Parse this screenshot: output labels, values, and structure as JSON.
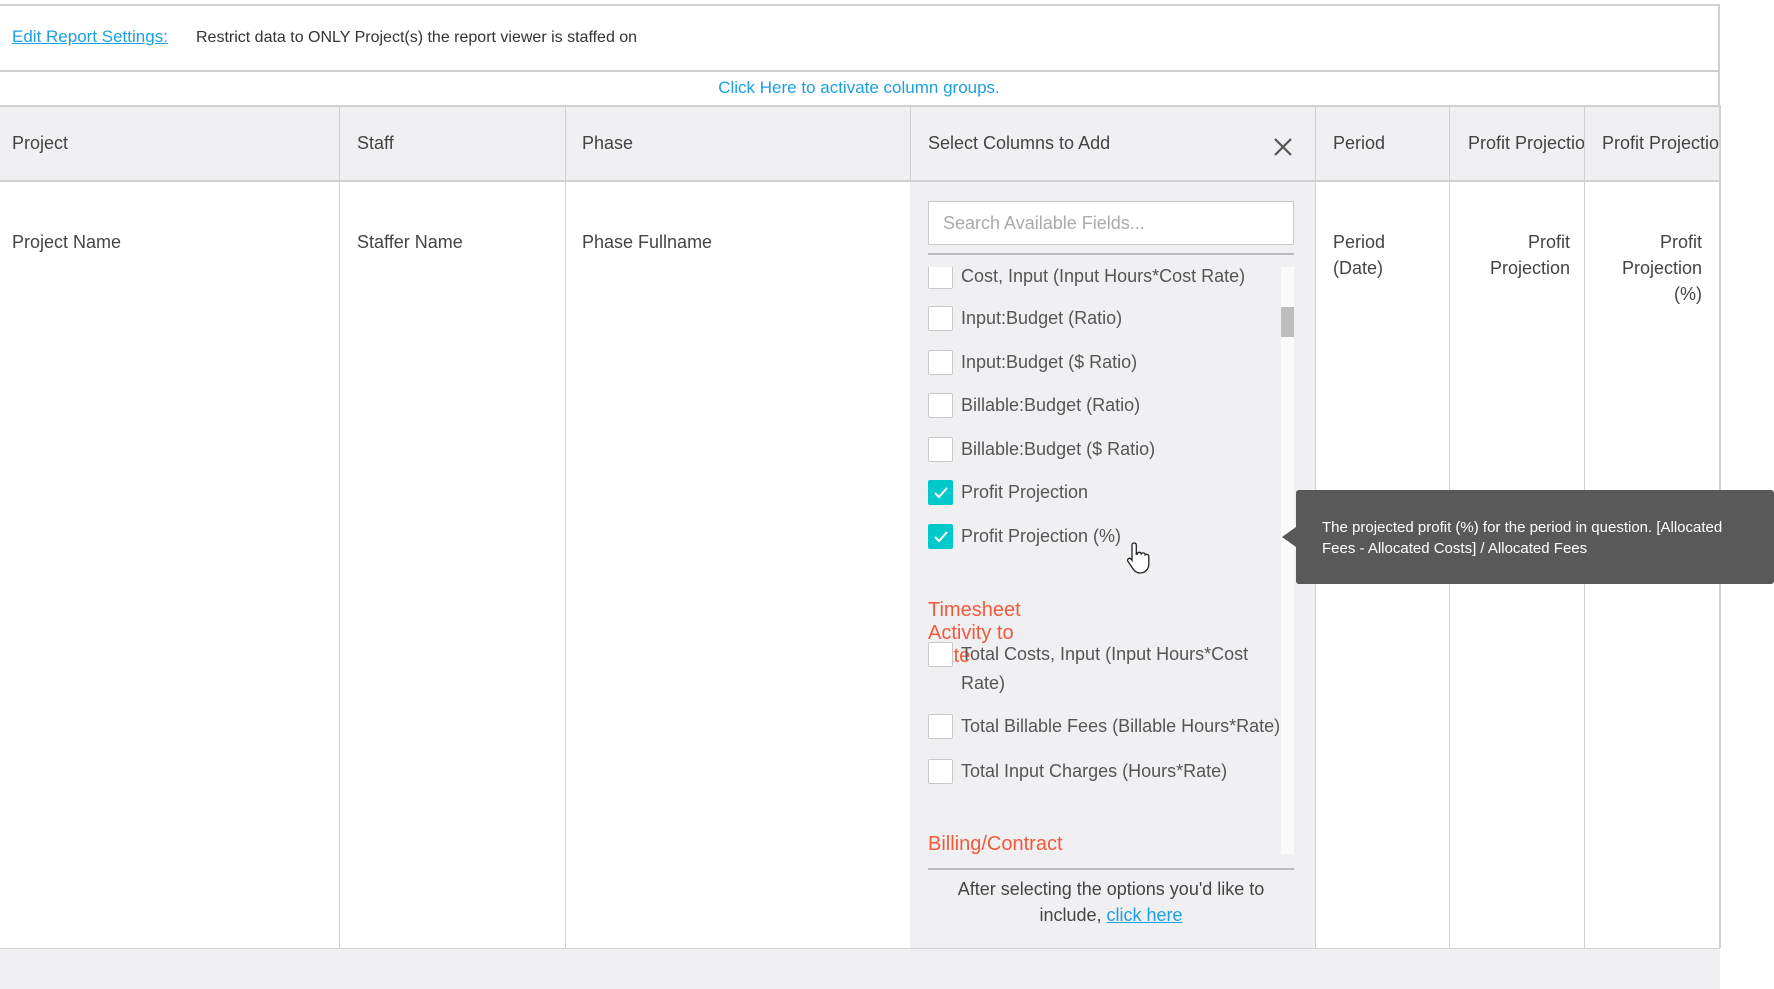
{
  "header": {
    "edit_link": "Edit Report Settings:",
    "restriction_text": "Restrict data to ONLY Project(s) the report viewer is staffed on"
  },
  "column_groups_link": "Click Here to activate column groups.",
  "table": {
    "columns": [
      "Project",
      "Staff",
      "Phase",
      "Select Columns to Add",
      "Period",
      "Profit Projectio",
      "Profit Projectio"
    ],
    "row": [
      "Project Name",
      "Staffer Name",
      "Phase Fullname",
      "Period (Date)",
      "Profit Projection",
      "Profit Projection (%)"
    ]
  },
  "panel": {
    "title": "Select Columns to Add",
    "search_placeholder": "Search Available Fields...",
    "items": [
      {
        "label": "Cost, Input (Input Hours*Cost Rate)",
        "checked": false
      },
      {
        "label": "Input:Budget (Ratio)",
        "checked": false
      },
      {
        "label": "Input:Budget ($ Ratio)",
        "checked": false
      },
      {
        "label": "Billable:Budget (Ratio)",
        "checked": false
      },
      {
        "label": "Billable:Budget ($ Ratio)",
        "checked": false
      },
      {
        "label": "Profit Projection",
        "checked": true
      },
      {
        "label": "Profit Projection (%)",
        "checked": true
      }
    ],
    "section1": "Timesheet Activity to Date",
    "items2": [
      {
        "label": "Total Costs, Input (Input Hours*Cost Rate)",
        "checked": false
      },
      {
        "label": "Total Billable Fees (Billable Hours*Rate)",
        "checked": false
      },
      {
        "label": "Total Input Charges (Hours*Rate)",
        "checked": false
      }
    ],
    "section2": "Billing/Contract Settings",
    "footnote": "After selecting the options you'd like to include,",
    "footnote_link": "click here"
  },
  "tooltip": "The projected profit (%) for the period in question. [Allocated Fees - Allocated Costs] / Allocated Fees",
  "colors": {
    "accent": "#00c9cc",
    "link": "#1a9fe0",
    "section": "#f05a3c",
    "tooltip": "#595959"
  }
}
